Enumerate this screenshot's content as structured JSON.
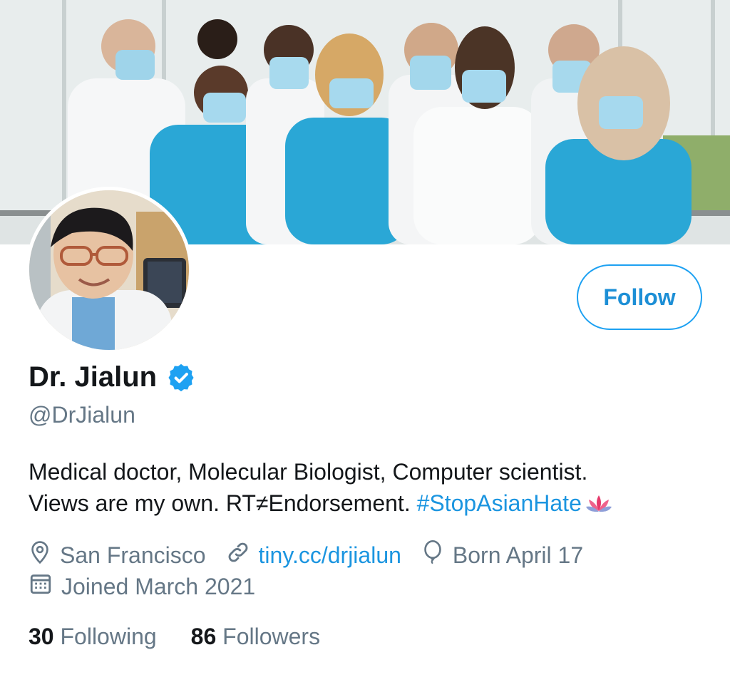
{
  "profile": {
    "display_name": "Dr. Jialun",
    "handle": "@DrJialun",
    "bio_line1": "Medical doctor, Molecular Biologist, Computer scientist.",
    "bio_line2_text": "Views are my own. RT≠Endorsement. ",
    "bio_hashtag": "#StopAsianHate",
    "location": "San Francisco",
    "website": "tiny.cc/drjialun",
    "birthday": "Born April 17",
    "joined": "Joined March 2021"
  },
  "actions": {
    "follow_label": "Follow"
  },
  "stats": {
    "following_count": "30",
    "following_label": "Following",
    "followers_count": "86",
    "followers_label": "Followers"
  },
  "icons": {
    "verified": "verified-badge-icon",
    "location": "location-pin-icon",
    "link": "link-icon",
    "birthday": "balloon-icon",
    "joined": "calendar-icon",
    "emoji": "lotus-icon"
  },
  "colors": {
    "accent": "#1da1f2",
    "link": "#1b95e0",
    "muted": "#657786",
    "text": "#14171a",
    "scrubs": "#2aa7d6"
  }
}
